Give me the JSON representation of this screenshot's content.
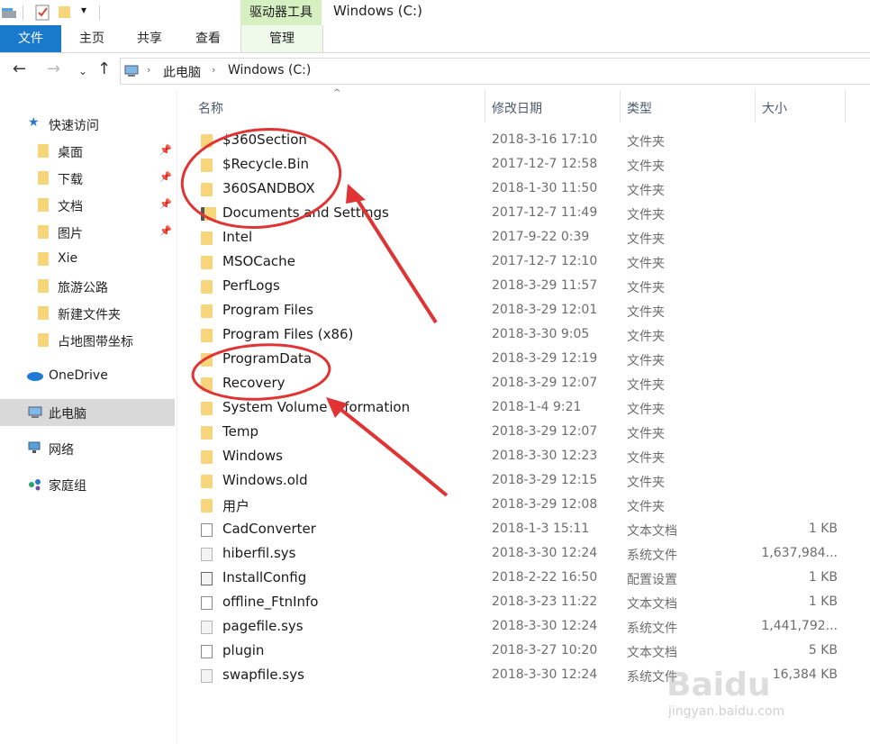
{
  "titlebar": {
    "context_tab": "驱动器工具",
    "window_title": "Windows (C:)"
  },
  "ribbon": {
    "tabs": [
      "文件",
      "主页",
      "共享",
      "查看",
      "管理"
    ]
  },
  "address": {
    "path": [
      "此电脑",
      "Windows (C:)"
    ]
  },
  "sidebar": {
    "quick_access": "快速访问",
    "quick_items": [
      {
        "label": "桌面",
        "pinned": true
      },
      {
        "label": "下载",
        "pinned": true
      },
      {
        "label": "文档",
        "pinned": true
      },
      {
        "label": "图片",
        "pinned": true
      },
      {
        "label": "Xie",
        "pinned": false
      },
      {
        "label": "旅游公路",
        "pinned": false
      },
      {
        "label": "新建文件夹",
        "pinned": false
      },
      {
        "label": "占地图带坐标",
        "pinned": false
      }
    ],
    "onedrive": "OneDrive",
    "this_pc": "此电脑",
    "network": "网络",
    "homegroup": "家庭组"
  },
  "columns": {
    "name": "名称",
    "date": "修改日期",
    "type": "类型",
    "size": "大小"
  },
  "files": [
    {
      "name": "$360Section",
      "date": "2018-3-16 17:10",
      "type": "文件夹",
      "size": "",
      "icon": "folder"
    },
    {
      "name": "$Recycle.Bin",
      "date": "2017-12-7 12:58",
      "type": "文件夹",
      "size": "",
      "icon": "folder"
    },
    {
      "name": "360SANDBOX",
      "date": "2018-1-30 11:50",
      "type": "文件夹",
      "size": "",
      "icon": "folder"
    },
    {
      "name": "Documents and Settings",
      "date": "2017-12-7 11:49",
      "type": "文件夹",
      "size": "",
      "icon": "shortcut"
    },
    {
      "name": "Intel",
      "date": "2017-9-22 0:39",
      "type": "文件夹",
      "size": "",
      "icon": "folder"
    },
    {
      "name": "MSOCache",
      "date": "2017-12-7 12:10",
      "type": "文件夹",
      "size": "",
      "icon": "folder"
    },
    {
      "name": "PerfLogs",
      "date": "2018-3-29 11:57",
      "type": "文件夹",
      "size": "",
      "icon": "folder"
    },
    {
      "name": "Program Files",
      "date": "2018-3-29 12:01",
      "type": "文件夹",
      "size": "",
      "icon": "folder"
    },
    {
      "name": "Program Files (x86)",
      "date": "2018-3-30 9:05",
      "type": "文件夹",
      "size": "",
      "icon": "folder"
    },
    {
      "name": "ProgramData",
      "date": "2018-3-29 12:19",
      "type": "文件夹",
      "size": "",
      "icon": "folder"
    },
    {
      "name": "Recovery",
      "date": "2018-3-29 12:07",
      "type": "文件夹",
      "size": "",
      "icon": "folder"
    },
    {
      "name": "System Volume Information",
      "date": "2018-1-4 9:21",
      "type": "文件夹",
      "size": "",
      "icon": "folder"
    },
    {
      "name": "Temp",
      "date": "2018-3-29 12:07",
      "type": "文件夹",
      "size": "",
      "icon": "folder"
    },
    {
      "name": "Windows",
      "date": "2018-3-30 12:23",
      "type": "文件夹",
      "size": "",
      "icon": "folder"
    },
    {
      "name": "Windows.old",
      "date": "2018-3-29 12:15",
      "type": "文件夹",
      "size": "",
      "icon": "folder"
    },
    {
      "name": "用户",
      "date": "2018-3-29 12:08",
      "type": "文件夹",
      "size": "",
      "icon": "folder"
    },
    {
      "name": "CadConverter",
      "date": "2018-1-3 15:11",
      "type": "文本文档",
      "size": "1 KB",
      "icon": "file"
    },
    {
      "name": "hiberfil.sys",
      "date": "2018-3-30 12:24",
      "type": "系统文件",
      "size": "1,637,984...",
      "icon": "sys"
    },
    {
      "name": "InstallConfig",
      "date": "2018-2-22 16:50",
      "type": "配置设置",
      "size": "1 KB",
      "icon": "config"
    },
    {
      "name": "offline_FtnInfo",
      "date": "2018-3-23 11:22",
      "type": "文本文档",
      "size": "1 KB",
      "icon": "file"
    },
    {
      "name": "pagefile.sys",
      "date": "2018-3-30 12:24",
      "type": "系统文件",
      "size": "1,441,792...",
      "icon": "sys"
    },
    {
      "name": "plugin",
      "date": "2018-3-27 10:20",
      "type": "文本文档",
      "size": "5 KB",
      "icon": "file"
    },
    {
      "name": "swapfile.sys",
      "date": "2018-3-30 12:24",
      "type": "系统文件",
      "size": "16,384 KB",
      "icon": "sys"
    }
  ],
  "watermark": {
    "brand": "Baidu",
    "site": "jingyan.baidu.com"
  },
  "colors": {
    "accent": "#1979ca",
    "annotation": "#e03434",
    "folder": "#f7d57b",
    "context_tab": "#d7f0c1"
  }
}
